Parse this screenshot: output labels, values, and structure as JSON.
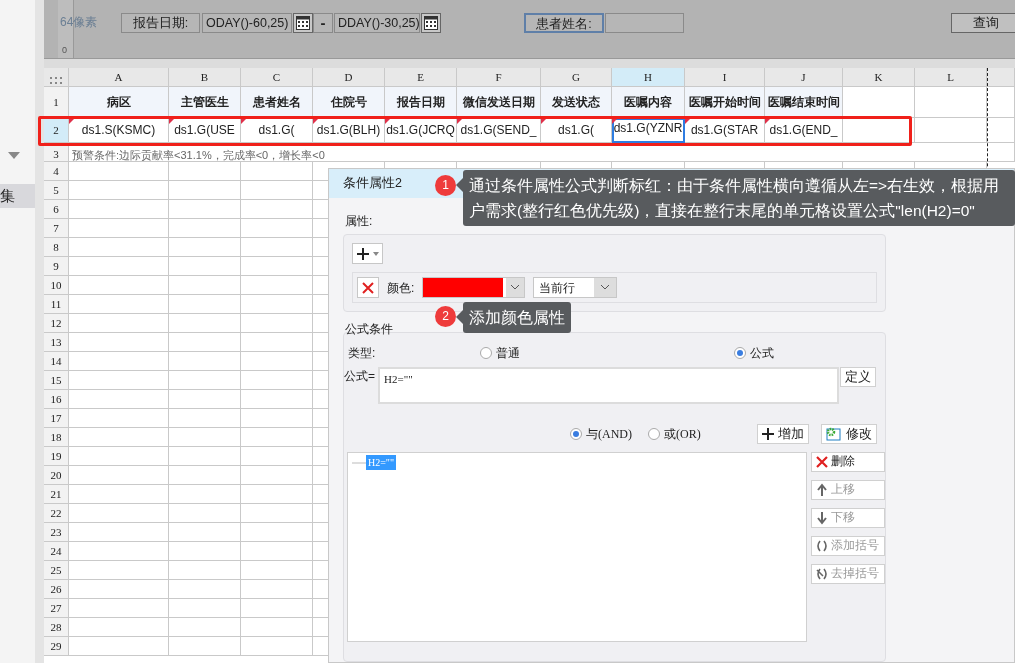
{
  "sidebar": {
    "label": "集"
  },
  "parameters": {
    "ruler_label": "64像素",
    "ruler_mark": "0",
    "date_label": "报告日期:",
    "start_value": "ODAY()-60,25)",
    "separator": "-",
    "end_value": "DDAY()-30,25)",
    "name_label": "患者姓名:",
    "name_selected": true,
    "query_button": "查询"
  },
  "sheet": {
    "columns": [
      {
        "letter": "A",
        "selected": false
      },
      {
        "letter": "B",
        "selected": false
      },
      {
        "letter": "C",
        "selected": false
      },
      {
        "letter": "D",
        "selected": false
      },
      {
        "letter": "E",
        "selected": false
      },
      {
        "letter": "F",
        "selected": false
      },
      {
        "letter": "G",
        "selected": false
      },
      {
        "letter": "H",
        "selected": true
      },
      {
        "letter": "I",
        "selected": false
      },
      {
        "letter": "J",
        "selected": false
      },
      {
        "letter": "K",
        "selected": false
      },
      {
        "letter": "L",
        "selected": false
      }
    ],
    "header_row": [
      "病区",
      "主管医生",
      "患者姓名",
      "住院号",
      "报告日期",
      "微信发送日期",
      "发送状态",
      "医嘱内容",
      "医嘱开始时间",
      "医嘱结束时间"
    ],
    "data_row": [
      {
        "text": "ds1.S(KSMC)",
        "selected": false
      },
      {
        "text": "ds1.G(USE",
        "selected": false
      },
      {
        "text": "ds1.G(",
        "selected": false
      },
      {
        "text": "ds1.G(BLH)",
        "selected": false
      },
      {
        "text": "ds1.G(JCRQ",
        "selected": false
      },
      {
        "text": "ds1.G(SEND_",
        "selected": false
      },
      {
        "text": "ds1.G(",
        "selected": false
      },
      {
        "text": "ds1.G(YZNR",
        "selected": true
      },
      {
        "text": "ds1.G(STAR",
        "selected": false
      },
      {
        "text": "ds1.G(END_",
        "selected": false
      }
    ],
    "note": "预警条件:边际贡献率<31.1%，完成率<0，增长率<0",
    "rows": [
      {
        "label": "1",
        "selected": false
      },
      {
        "label": "2",
        "selected": true
      },
      {
        "label": "3",
        "selected": false
      },
      {
        "label": "4",
        "selected": false
      },
      {
        "label": "5",
        "selected": false
      },
      {
        "label": "6",
        "selected": false
      },
      {
        "label": "7",
        "selected": false
      },
      {
        "label": "8",
        "selected": false
      },
      {
        "label": "9",
        "selected": false
      },
      {
        "label": "10",
        "selected": false
      },
      {
        "label": "11",
        "selected": false
      },
      {
        "label": "12",
        "selected": false
      },
      {
        "label": "13",
        "selected": false
      },
      {
        "label": "14",
        "selected": false
      },
      {
        "label": "15",
        "selected": false
      },
      {
        "label": "16",
        "selected": false
      },
      {
        "label": "17",
        "selected": false
      },
      {
        "label": "18",
        "selected": false
      },
      {
        "label": "19",
        "selected": false
      },
      {
        "label": "20",
        "selected": false
      },
      {
        "label": "21",
        "selected": false
      },
      {
        "label": "22",
        "selected": false
      },
      {
        "label": "23",
        "selected": false
      },
      {
        "label": "24",
        "selected": false
      },
      {
        "label": "25",
        "selected": false
      },
      {
        "label": "26",
        "selected": false
      },
      {
        "label": "27",
        "selected": false
      },
      {
        "label": "28",
        "selected": false
      },
      {
        "label": "29",
        "selected": false
      }
    ]
  },
  "dialog": {
    "title": "条件属性2",
    "attributes_label": "属性:",
    "color_label": "颜色:",
    "color": "#ff0000",
    "scope": "当前行",
    "formula_group": {
      "title": "公式条件",
      "type_label": "类型:",
      "types": [
        {
          "label": "普通",
          "selected": false
        },
        {
          "label": "公式",
          "selected": true
        }
      ],
      "formula_label": "公式=",
      "formula": "H2=\"\"",
      "define_button": "定义",
      "logic": [
        {
          "label": "与(AND)",
          "selected": true
        },
        {
          "label": "或(OR)",
          "selected": false
        }
      ],
      "add_button": "增加",
      "modify_button": "修改",
      "conditions": [
        {
          "text": "H2=\"\"",
          "selected": true
        }
      ],
      "side_buttons": [
        {
          "kind": "delete",
          "label": "删除",
          "disabled": false
        },
        {
          "kind": "up",
          "label": "上移",
          "disabled": true
        },
        {
          "kind": "down",
          "label": "下移",
          "disabled": true
        },
        {
          "kind": "add-paren",
          "label": "添加括号",
          "disabled": true
        },
        {
          "kind": "remove-paren",
          "label": "去掉括号",
          "disabled": true
        }
      ]
    }
  },
  "annotations": [
    {
      "number": "1",
      "text": "通过条件属性公式判断标红：由于条件属性横向遵循从左=>右生效，根据用户需求(整行红色优先级)，直接在整行末尾的单元格设置公式\"len(H2)=0\""
    },
    {
      "number": "2",
      "text": "添加颜色属性"
    }
  ]
}
